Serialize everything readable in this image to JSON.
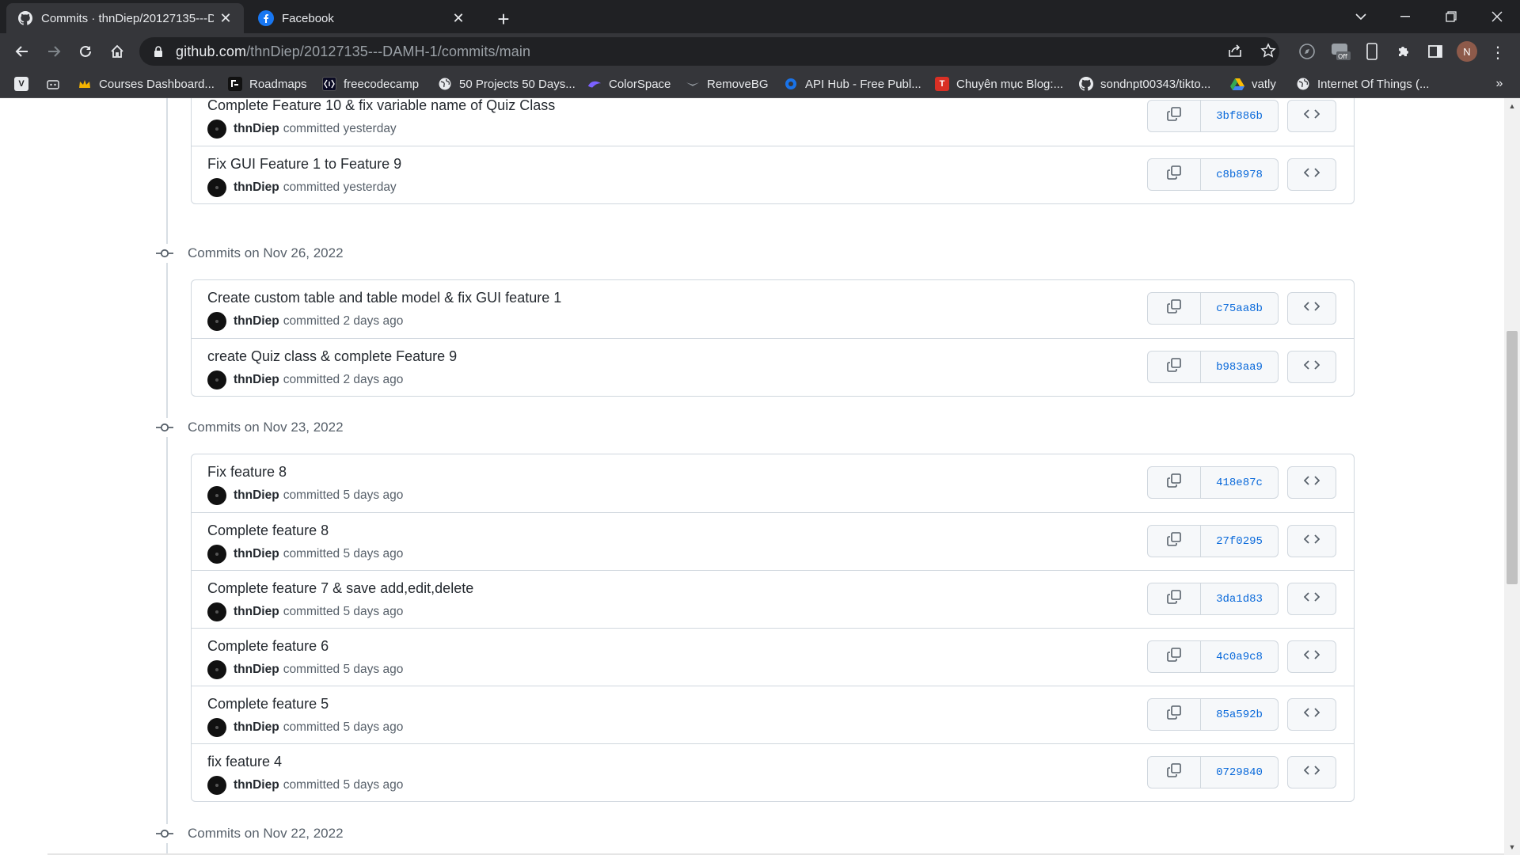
{
  "browser": {
    "tabs": [
      {
        "title": "Commits · thnDiep/20127135---D",
        "favicon": "github-icon",
        "active": true
      },
      {
        "title": "Facebook",
        "favicon": "facebook-icon",
        "active": false
      }
    ],
    "url_host": "github.com",
    "url_path": "/thnDiep/20127135---DAMH-1/commits/main",
    "profile_initial": "N",
    "bookmarks": [
      {
        "label": "",
        "icon": "v-icon"
      },
      {
        "label": "",
        "icon": "robot-icon"
      },
      {
        "label": "Courses Dashboard...",
        "icon": "crown-icon"
      },
      {
        "label": "Roadmaps",
        "icon": "roadmap-icon"
      },
      {
        "label": "freecodecamp",
        "icon": "freecodecamp-icon"
      },
      {
        "label": "50 Projects 50 Days...",
        "icon": "globe-icon"
      },
      {
        "label": "ColorSpace",
        "icon": "colorspace-icon"
      },
      {
        "label": "RemoveBG",
        "icon": "removebg-icon"
      },
      {
        "label": "API Hub - Free Publ...",
        "icon": "apihub-icon"
      },
      {
        "label": "Chuyên mục Blog:...",
        "icon": "t-icon"
      },
      {
        "label": "sondnpt00343/tikto...",
        "icon": "github-icon"
      },
      {
        "label": "vatly",
        "icon": "drive-icon"
      },
      {
        "label": "Internet Of Things (...",
        "icon": "globe-icon"
      }
    ]
  },
  "commit_groups": [
    {
      "label": "",
      "commits": [
        {
          "message": "Complete Feature 10 & fix variable name of Quiz Class",
          "author": "thnDiep",
          "time": "committed yesterday",
          "sha": "3bf886b"
        },
        {
          "message": "Fix GUI Feature 1 to Feature 9",
          "author": "thnDiep",
          "time": "committed yesterday",
          "sha": "c8b8978"
        }
      ]
    },
    {
      "label": "Commits on Nov 26, 2022",
      "commits": [
        {
          "message": "Create custom table and table model & fix GUI feature 1",
          "author": "thnDiep",
          "time": "committed 2 days ago",
          "sha": "c75aa8b"
        },
        {
          "message": "create Quiz class & complete Feature 9",
          "author": "thnDiep",
          "time": "committed 2 days ago",
          "sha": "b983aa9"
        }
      ]
    },
    {
      "label": "Commits on Nov 23, 2022",
      "commits": [
        {
          "message": "Fix feature 8",
          "author": "thnDiep",
          "time": "committed 5 days ago",
          "sha": "418e87c"
        },
        {
          "message": "Complete feature 8",
          "author": "thnDiep",
          "time": "committed 5 days ago",
          "sha": "27f0295"
        },
        {
          "message": "Complete feature 7 & save add,edit,delete",
          "author": "thnDiep",
          "time": "committed 5 days ago",
          "sha": "3da1d83"
        },
        {
          "message": "Complete feature 6",
          "author": "thnDiep",
          "time": "committed 5 days ago",
          "sha": "4c0a9c8"
        },
        {
          "message": "Complete feature 5",
          "author": "thnDiep",
          "time": "committed 5 days ago",
          "sha": "85a592b"
        },
        {
          "message": "fix feature 4",
          "author": "thnDiep",
          "time": "committed 5 days ago",
          "sha": "0729840"
        }
      ]
    },
    {
      "label": "Commits on Nov 22, 2022",
      "commits": []
    }
  ],
  "colors": {
    "link_blue": "#0969da",
    "text_primary": "#24292f",
    "text_muted": "#57606a",
    "border": "#d0d7de",
    "chrome_dark": "#202124",
    "chrome_toolbar": "#35363a"
  }
}
